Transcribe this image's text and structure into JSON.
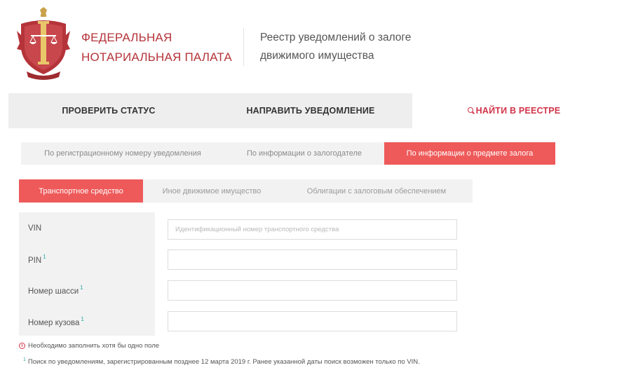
{
  "header": {
    "org_name_line1": "ФЕДЕРАЛЬНАЯ",
    "org_name_line2": "НОТАРИАЛЬНАЯ ПАЛАТА",
    "registry_line1": "Реестр уведомлений о залоге",
    "registry_line2": "движимого имущества"
  },
  "main_nav": {
    "check_status": "ПРОВЕРИТЬ СТАТУС",
    "send_notice": "НАПРАВИТЬ УВЕДОМЛЕНИЕ",
    "find_in_registry": "НАЙТИ В РЕЕСТРЕ"
  },
  "search_tabs": {
    "by_reg_number": "По регистрационному номеру уведомления",
    "by_pledgor": "По информации о залогодателе",
    "by_subject": "По информации о предмете залога"
  },
  "object_tabs": {
    "vehicle": "Транспортное средство",
    "other_property": "Иное движимое имущество",
    "secured_bonds": "Облигации с залоговым обеспечением"
  },
  "form": {
    "vin_label": "VIN",
    "vin_placeholder": "Идентификационный номер транспортного средства",
    "pin_label": "PIN",
    "chassis_label": "Номер шасси",
    "body_label": "Номер кузова",
    "footnote_mark": "1"
  },
  "notes": {
    "required": "Необходимо заполнить хотя бы одно поле",
    "footnote_mark": "1",
    "footnote": "Поиск по уведомлениям, зарегистрированным позднее 12 марта 2019 г. Ранее указанной даты поиск возможен только по VIN."
  },
  "colors": {
    "brand_red": "#b5343a",
    "active_tab": "#ee5a5a",
    "accent_red": "#d2344a",
    "footnote_teal": "#2aa9a0"
  }
}
